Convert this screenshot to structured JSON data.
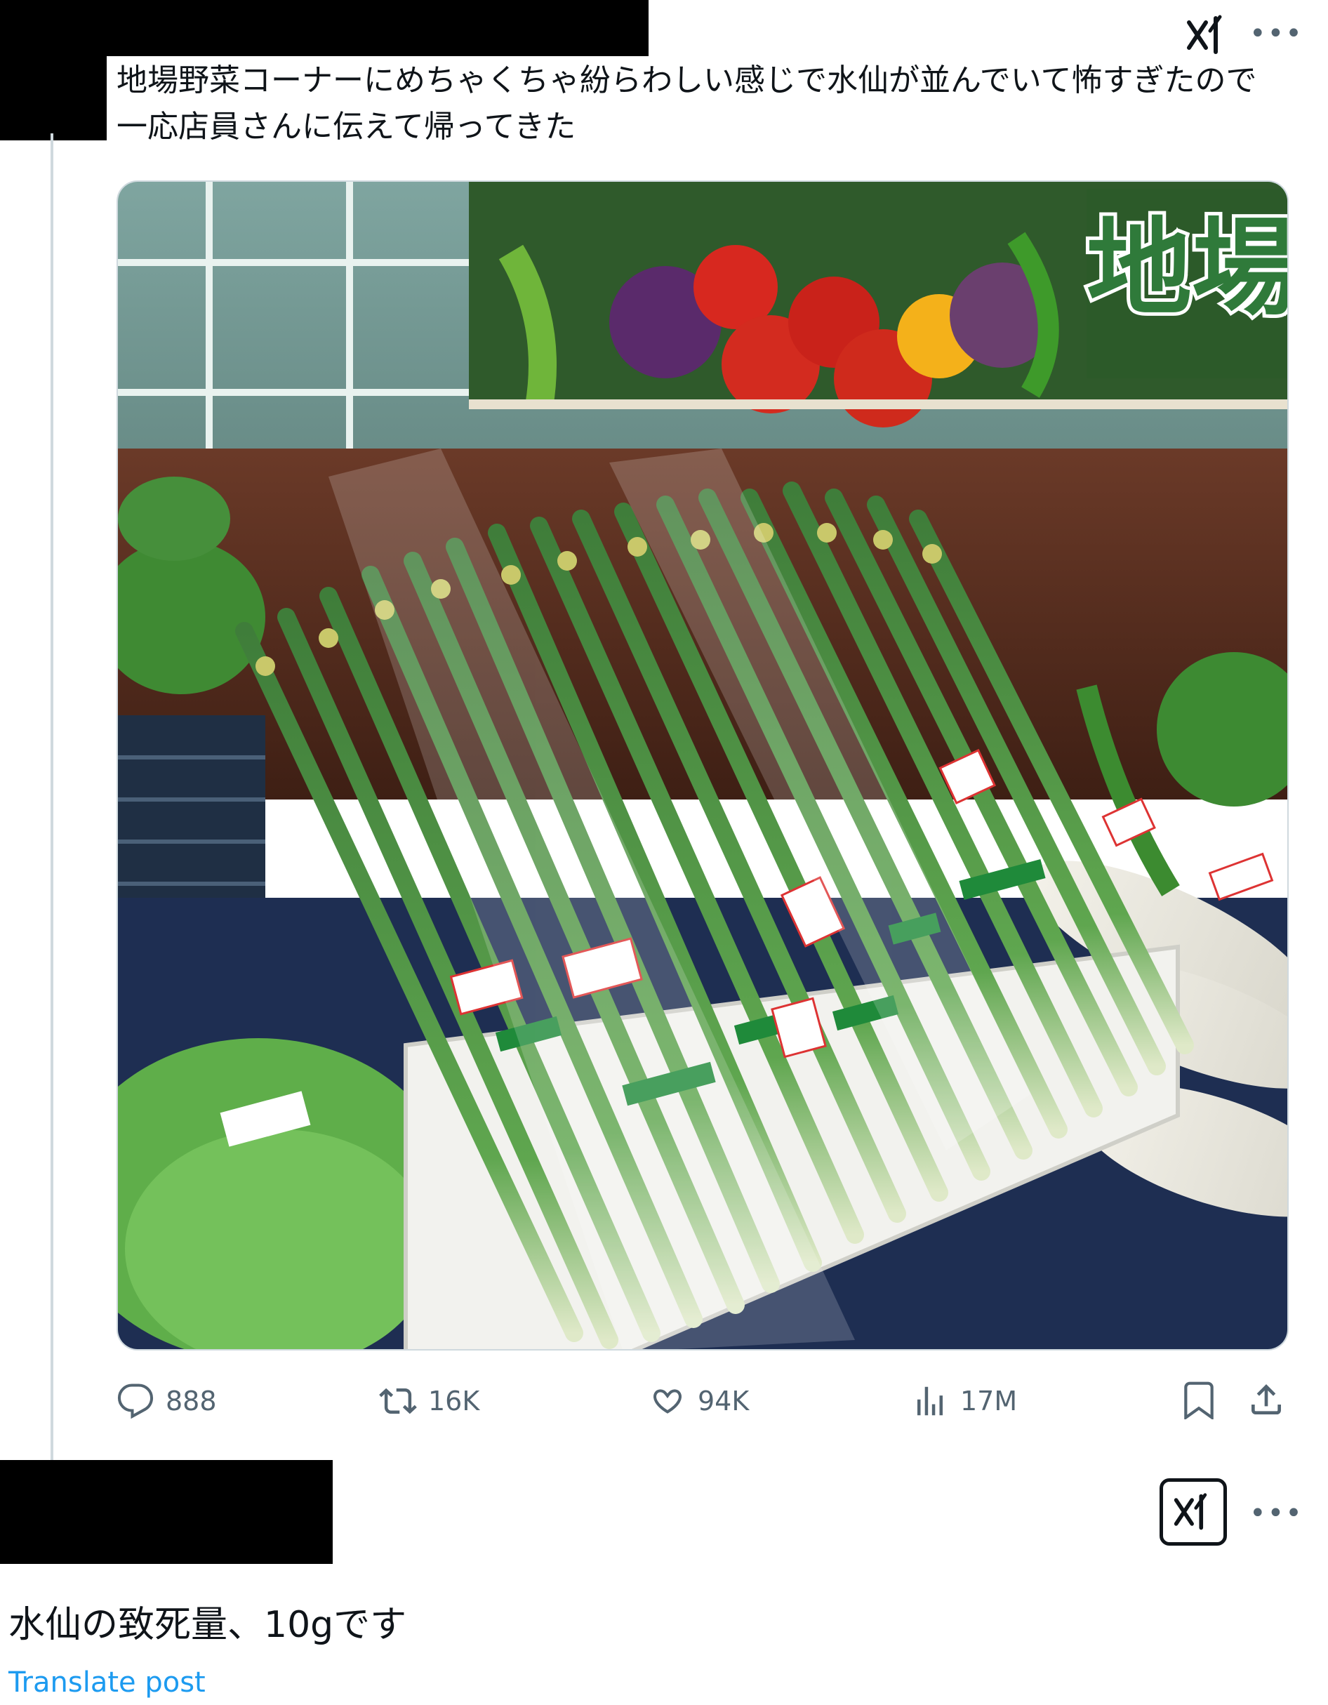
{
  "post": {
    "text": "地場野菜コーナーにめちゃくちゃ紛らわしい感じで水仙が並んでいて怖すぎたので一応店員さんに伝えて帰ってきた",
    "media": {
      "sign_text": "地場",
      "image_description_icon": "photo"
    },
    "stats": {
      "replies": "888",
      "reposts": "16K",
      "likes": "94K",
      "views": "17M"
    }
  },
  "reply": {
    "text": "水仙の致死量、10gです",
    "translate_label": "Translate post"
  },
  "icons": {
    "grok": "grok-icon",
    "more": "more-icon",
    "reply": "reply-icon",
    "repost": "repost-icon",
    "like": "heart-icon",
    "views": "views-icon",
    "bookmark": "bookmark-icon",
    "share": "share-icon"
  },
  "colors": {
    "text": "#0f1419",
    "secondary": "#536471",
    "link": "#1d9bf0",
    "border": "#cfd9de"
  }
}
